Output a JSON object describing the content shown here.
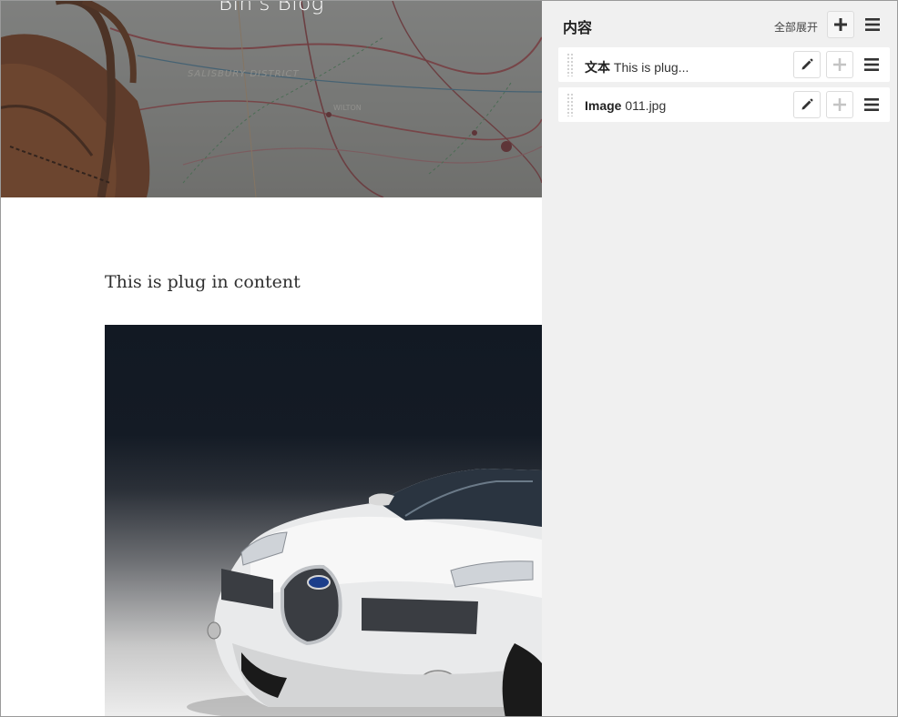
{
  "site": {
    "title": "Bin's Blog",
    "map_labels": [
      "SALISBURY DISTRICT",
      "WILTON"
    ],
    "content_text": "This is plug in content",
    "content_image": {
      "subject": "white concept sports car",
      "filename": "011.jpg"
    }
  },
  "structure_panel": {
    "title": "内容",
    "expand_all_label": "全部展开",
    "header_buttons": {
      "add": "plus-icon",
      "menu": "hamburger-menu-icon"
    },
    "plugins": [
      {
        "type_label": "文本",
        "summary": "This is plug..."
      },
      {
        "type_label": "Image",
        "summary": "011.jpg"
      }
    ]
  },
  "colors": {
    "panel_background": "#f0f0f0",
    "row_background": "#ffffff",
    "car_image_top": "#121923"
  }
}
